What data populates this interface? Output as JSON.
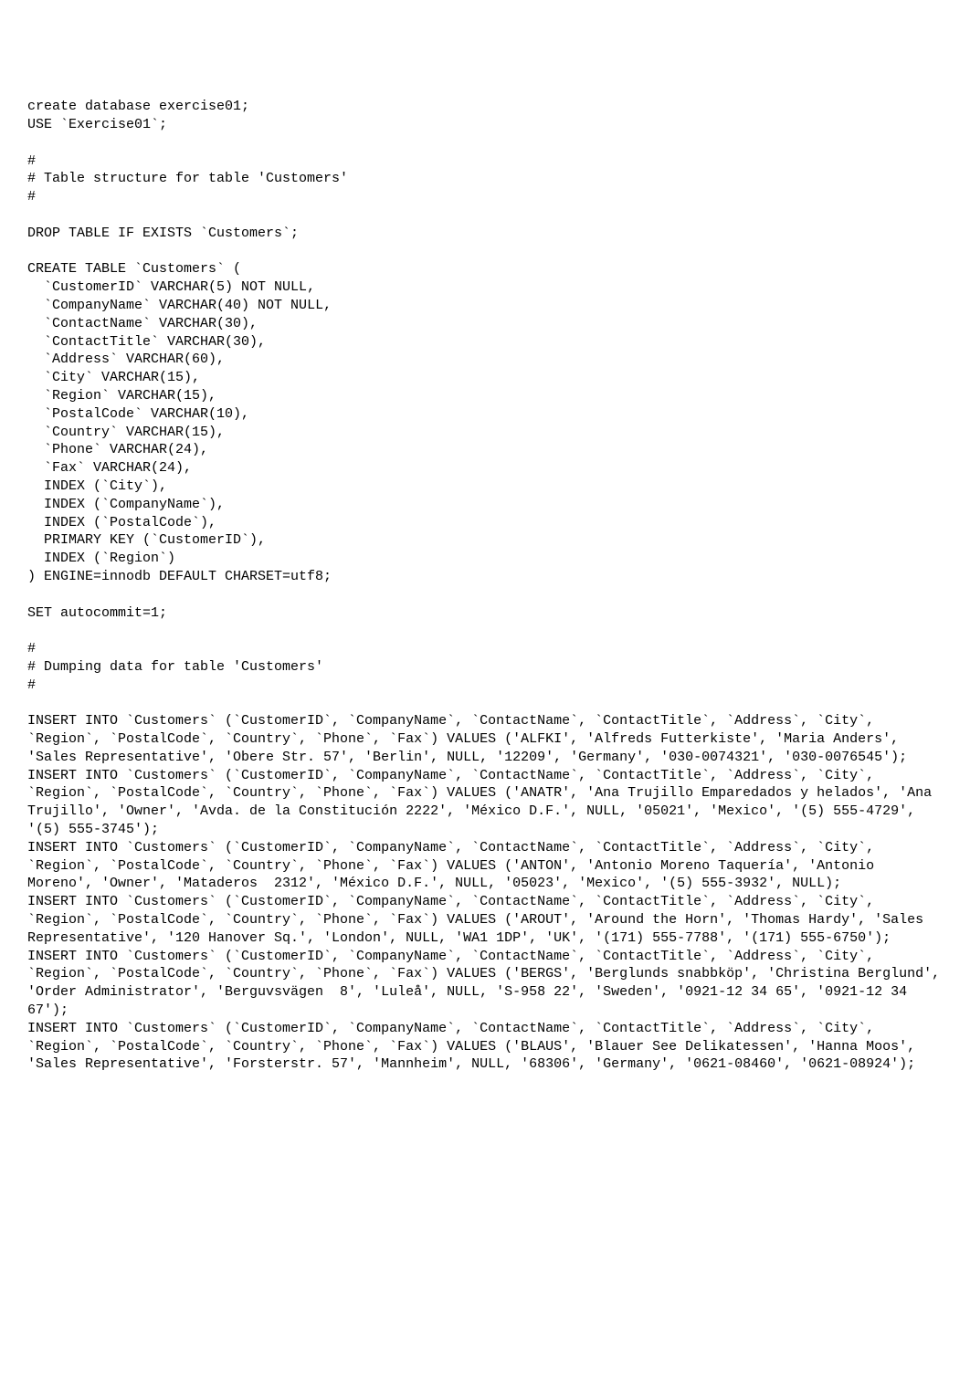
{
  "document": {
    "lines": [
      "create database exercise01;",
      "USE `Exercise01`;",
      "",
      "#",
      "# Table structure for table 'Customers'",
      "#",
      "",
      "DROP TABLE IF EXISTS `Customers`;",
      "",
      "CREATE TABLE `Customers` (",
      "  `CustomerID` VARCHAR(5) NOT NULL,",
      "  `CompanyName` VARCHAR(40) NOT NULL,",
      "  `ContactName` VARCHAR(30),",
      "  `ContactTitle` VARCHAR(30),",
      "  `Address` VARCHAR(60),",
      "  `City` VARCHAR(15),",
      "  `Region` VARCHAR(15),",
      "  `PostalCode` VARCHAR(10),",
      "  `Country` VARCHAR(15),",
      "  `Phone` VARCHAR(24),",
      "  `Fax` VARCHAR(24),",
      "  INDEX (`City`),",
      "  INDEX (`CompanyName`),",
      "  INDEX (`PostalCode`),",
      "  PRIMARY KEY (`CustomerID`),",
      "  INDEX (`Region`)",
      ") ENGINE=innodb DEFAULT CHARSET=utf8;",
      "",
      "SET autocommit=1;",
      "",
      "#",
      "# Dumping data for table 'Customers'",
      "#",
      "",
      "INSERT INTO `Customers` (`CustomerID`, `CompanyName`, `ContactName`, `ContactTitle`, `Address`, `City`, `Region`, `PostalCode`, `Country`, `Phone`, `Fax`) VALUES ('ALFKI', 'Alfreds Futterkiste', 'Maria Anders', 'Sales Representative', 'Obere Str. 57', 'Berlin', NULL, '12209', 'Germany', '030-0074321', '030-0076545');",
      "INSERT INTO `Customers` (`CustomerID`, `CompanyName`, `ContactName`, `ContactTitle`, `Address`, `City`, `Region`, `PostalCode`, `Country`, `Phone`, `Fax`) VALUES ('ANATR', 'Ana Trujillo Emparedados y helados', 'Ana Trujillo', 'Owner', 'Avda. de la Constitución 2222', 'México D.F.', NULL, '05021', 'Mexico', '(5) 555-4729', '(5) 555-3745');",
      "INSERT INTO `Customers` (`CustomerID`, `CompanyName`, `ContactName`, `ContactTitle`, `Address`, `City`, `Region`, `PostalCode`, `Country`, `Phone`, `Fax`) VALUES ('ANTON', 'Antonio Moreno Taquería', 'Antonio Moreno', 'Owner', 'Mataderos  2312', 'México D.F.', NULL, '05023', 'Mexico', '(5) 555-3932', NULL);",
      "INSERT INTO `Customers` (`CustomerID`, `CompanyName`, `ContactName`, `ContactTitle`, `Address`, `City`, `Region`, `PostalCode`, `Country`, `Phone`, `Fax`) VALUES ('AROUT', 'Around the Horn', 'Thomas Hardy', 'Sales Representative', '120 Hanover Sq.', 'London', NULL, 'WA1 1DP', 'UK', '(171) 555-7788', '(171) 555-6750');",
      "INSERT INTO `Customers` (`CustomerID`, `CompanyName`, `ContactName`, `ContactTitle`, `Address`, `City`, `Region`, `PostalCode`, `Country`, `Phone`, `Fax`) VALUES ('BERGS', 'Berglunds snabbköp', 'Christina Berglund', 'Order Administrator', 'Berguvsvägen  8', 'Luleå', NULL, 'S-958 22', 'Sweden', '0921-12 34 65', '0921-12 34 67');",
      "INSERT INTO `Customers` (`CustomerID`, `CompanyName`, `ContactName`, `ContactTitle`, `Address`, `City`, `Region`, `PostalCode`, `Country`, `Phone`, `Fax`) VALUES ('BLAUS', 'Blauer See Delikatessen', 'Hanna Moos', 'Sales Representative', 'Forsterstr. 57', 'Mannheim', NULL, '68306', 'Germany', '0621-08460', '0621-08924');"
    ]
  }
}
